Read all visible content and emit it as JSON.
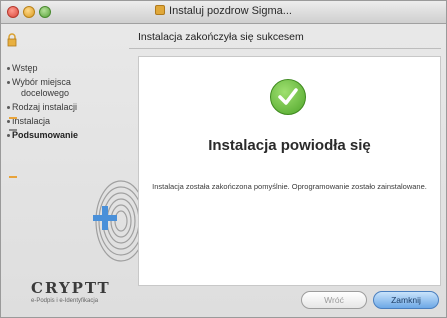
{
  "window": {
    "title": "Instaluj pozdrow Sigma...",
    "heading": "Instalacja zakończyła się sukcesem"
  },
  "sidebar": {
    "steps": [
      {
        "label": "Wstęp"
      },
      {
        "label": "Wybór miejsca"
      },
      {
        "label": "docelowego",
        "continuation": true
      },
      {
        "label": "Rodzaj instalacji"
      },
      {
        "label": "Instalacja"
      },
      {
        "label": "Podsumowanie",
        "current": true
      }
    ]
  },
  "brand": {
    "name": "CRYPTT",
    "tagline": "e-Podpis i e-Identyfikacja"
  },
  "content": {
    "title": "Instalacja powiodła się",
    "message": "Instalacja została zakończona pomyślnie. Oprogramowanie zostało zainstalowane."
  },
  "buttons": {
    "back": "Wróć",
    "close": "Zamknij"
  },
  "colors": {
    "accent_orange": "#e8a33a",
    "success_green": "#4fa52a",
    "primary_blue": "#6da8e6"
  }
}
